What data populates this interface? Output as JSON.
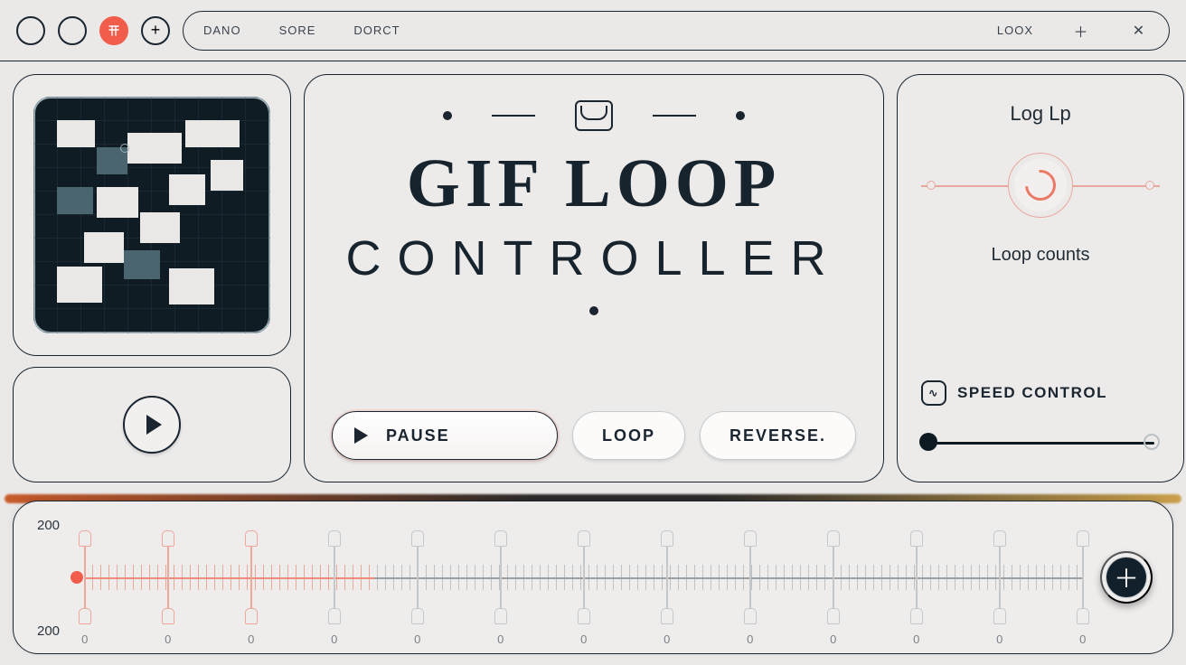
{
  "topbar": {
    "menu": [
      "DANO",
      "SORE",
      "DORCT"
    ],
    "right_label": "LOOX"
  },
  "title": {
    "line1": "GIF LOOP",
    "line2": "CONTROLLER"
  },
  "buttons": {
    "pause": "PAUSE",
    "loop": "LOOP",
    "reverse": "REVERSE."
  },
  "right": {
    "loglp": "Log Lp",
    "loop_counts": "Loop counts",
    "speed_label": "SPEED CONTROL"
  },
  "timeline": {
    "top_value": "200",
    "bottom_value": "200",
    "tick_label": "0",
    "major_ticks": 13,
    "red_ticks": 3,
    "progress_pct": 25
  },
  "colors": {
    "accent": "#f25c4a",
    "ink": "#1a2530"
  }
}
